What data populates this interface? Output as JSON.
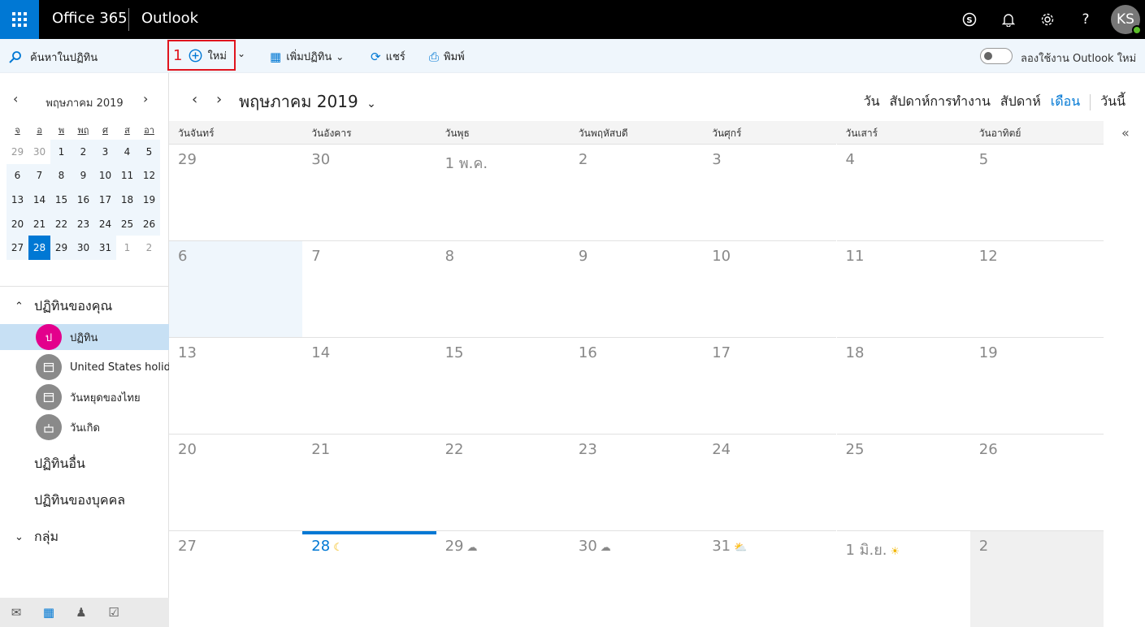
{
  "topbar": {
    "brand": "Office 365",
    "app": "Outlook",
    "avatar_initials": "KS",
    "icons": [
      "skype-icon",
      "bell-icon",
      "gear-icon",
      "help-icon"
    ]
  },
  "cmdbar": {
    "search_label": "ค้นหาในปฏิทิน",
    "annotation_number": "1",
    "new_label": "ใหม่",
    "add_calendar_label": "เพิ่มปฏิทิน",
    "share_label": "แชร์",
    "print_label": "พิมพ์",
    "try_new_label": "ลองใช้งาน Outlook ใหม่"
  },
  "mini_calendar": {
    "title": "พฤษภาคม 2019",
    "weekday_headers": [
      "จ",
      "อ",
      "พ",
      "พฤ",
      "ศ",
      "ส",
      "อา"
    ],
    "weeks": [
      [
        "29",
        "30",
        "1",
        "2",
        "3",
        "4",
        "5"
      ],
      [
        "6",
        "7",
        "8",
        "9",
        "10",
        "11",
        "12"
      ],
      [
        "13",
        "14",
        "15",
        "16",
        "17",
        "18",
        "19"
      ],
      [
        "20",
        "21",
        "22",
        "23",
        "24",
        "25",
        "26"
      ],
      [
        "27",
        "28",
        "29",
        "30",
        "31",
        "1",
        "2"
      ]
    ],
    "selected": "28"
  },
  "sidebar": {
    "your_calendars_label": "ปฏิทินของคุณ",
    "calendars": [
      {
        "label": "ปฏิทิน",
        "avatar": "ป",
        "color": "#e3008c"
      },
      {
        "label": "United States holidays",
        "avatar": "",
        "color": "#8a8a8a"
      },
      {
        "label": "วันหยุดของไทย",
        "avatar": "",
        "color": "#8a8a8a"
      },
      {
        "label": "วันเกิด",
        "avatar": "",
        "color": "#8a8a8a"
      }
    ],
    "other_calendars_label": "ปฏิทินอื่น",
    "people_calendars_label": "ปฏิทินของบุคคล",
    "groups_label": "กลุ่ม"
  },
  "main": {
    "month_title": "พฤษภาคม 2019",
    "views": [
      "วัน",
      "สัปดาห์การทำงาน",
      "สัปดาห์",
      "เดือน"
    ],
    "current_view": "เดือน",
    "today_label": "วันนี้",
    "day_names": [
      "วันจันทร์",
      "วันอังคาร",
      "วันพุธ",
      "วันพฤหัสบดี",
      "วันศุกร์",
      "วันเสาร์",
      "วันอาทิตย์"
    ],
    "weeks": [
      [
        "29",
        "30",
        "1 พ.ค.",
        "2",
        "3",
        "4",
        "5"
      ],
      [
        "6",
        "7",
        "8",
        "9",
        "10",
        "11",
        "12"
      ],
      [
        "13",
        "14",
        "15",
        "16",
        "17",
        "18",
        "19"
      ],
      [
        "20",
        "21",
        "22",
        "23",
        "24",
        "25",
        "26"
      ],
      [
        "27",
        "28",
        "29",
        "30",
        "31",
        "1 มิ.ย.",
        "2"
      ]
    ],
    "weather_icons": {
      "28": "moon-icon",
      "29": "cloud-icon",
      "30": "cloud-icon",
      "31": "partly-sunny-icon",
      "1 มิ.ย.": "sun-icon"
    },
    "accent_color": "#0078d4"
  }
}
